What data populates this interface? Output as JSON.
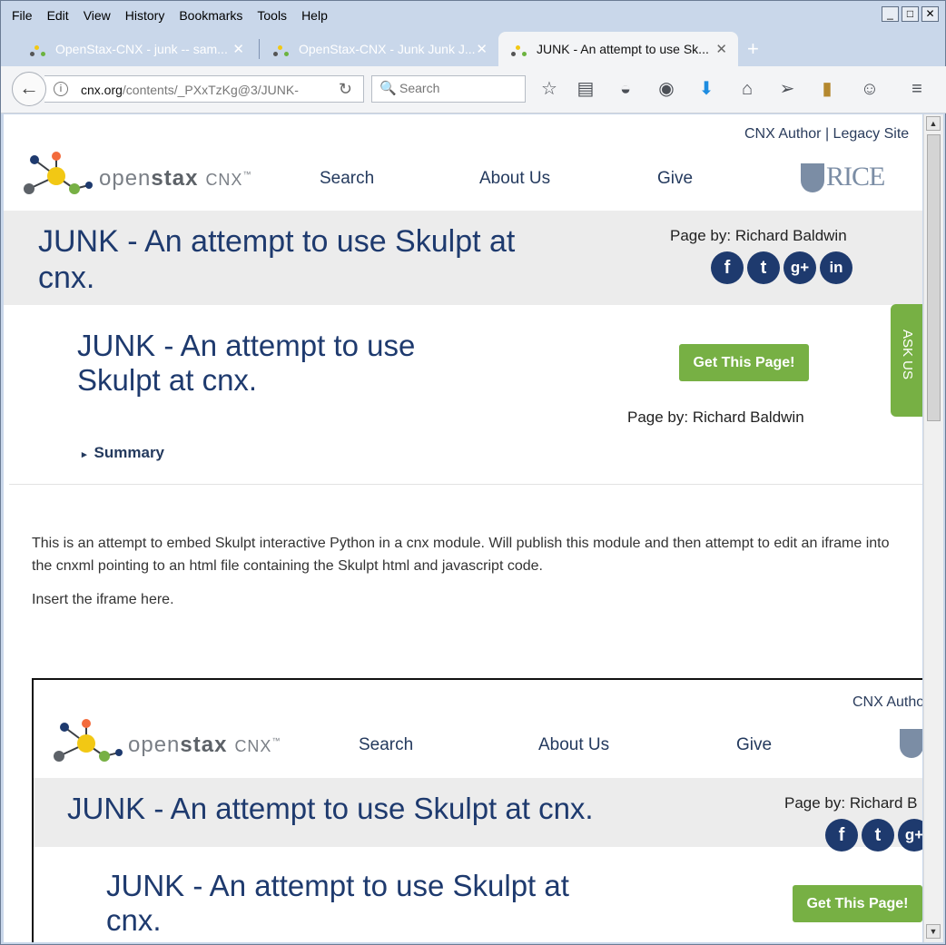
{
  "menu": [
    "File",
    "Edit",
    "View",
    "History",
    "Bookmarks",
    "Tools",
    "Help"
  ],
  "tabs": [
    {
      "title": "OpenStax-CNX - junk -- sam..."
    },
    {
      "title": "OpenStax-CNX - Junk Junk J..."
    },
    {
      "title": "JUNK - An attempt to use Sk..."
    }
  ],
  "url": {
    "host": "cnx.org",
    "path": "/contents/_PXxTzKg@3/JUNK-"
  },
  "search": {
    "placeholder": "Search"
  },
  "header": {
    "cnx_author": "CNX Author",
    "sep": "|",
    "legacy": "Legacy Site",
    "logo_open": "open",
    "logo_stax": "stax",
    "logo_cnx": "CNX",
    "nav": [
      "Search",
      "About Us",
      "Give"
    ],
    "rice": "RICE"
  },
  "page": {
    "title_line1": "JUNK - An attempt to use Skulpt at",
    "title_line2": "cnx.",
    "byline": "Page by: Richard Baldwin",
    "content_title_line1": "JUNK - An attempt to use",
    "content_title_line2": "Skulpt at cnx.",
    "get_button": "Get This Page!",
    "byline2": "Page by: Richard Baldwin",
    "summary": "Summary",
    "ask_us": "ASK US",
    "para1": "This is an attempt to embed Skulpt interactive Python in a cnx module. Will publish this module and then attempt to edit an iframe into the cnxml pointing to an html file containing the Skulpt html and javascript code.",
    "para2": "Insert the iframe here."
  },
  "iframe": {
    "cnx_author": "CNX Autho",
    "nav": [
      "Search",
      "About Us",
      "Give"
    ],
    "title": "JUNK - An attempt to use Skulpt at cnx.",
    "byline": "Page by: Richard B",
    "content_title_line1": "JUNK - An attempt to use Skulpt at",
    "content_title_line2": "cnx.",
    "get_button": "Get This Page!"
  },
  "social_icons": [
    "facebook-icon",
    "twitter-icon",
    "google-plus-icon",
    "linkedin-icon"
  ],
  "colors": {
    "accent_green": "#77b044",
    "navy": "#1e3a6e",
    "tab_strip": "#c9d7ea"
  }
}
